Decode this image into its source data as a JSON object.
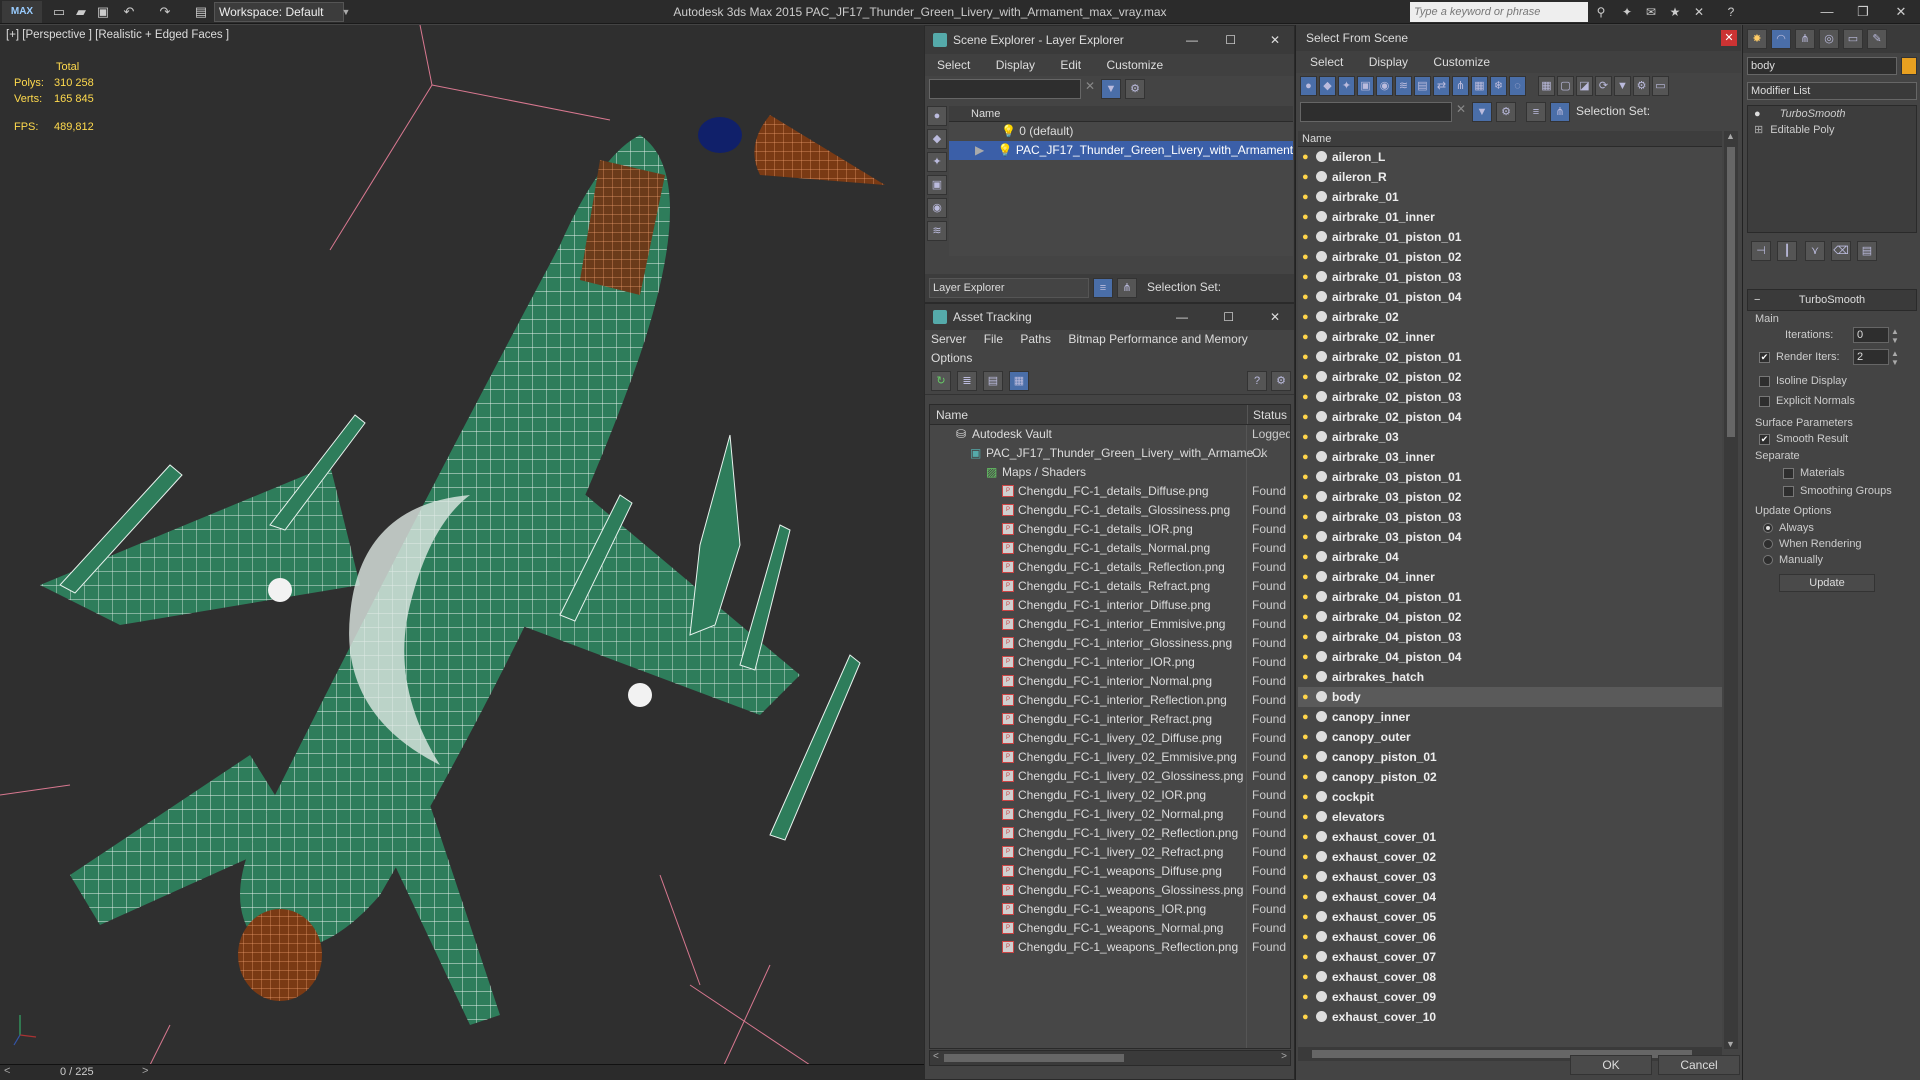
{
  "titlebar": {
    "logo": "MAX",
    "workspace": "Workspace: Default",
    "title": "Autodesk 3ds Max  2015     PAC_JF17_Thunder_Green_Livery_with_Armament_max_vray.max",
    "search_placeholder": "Type a keyword or phrase"
  },
  "viewport": {
    "label": "[+] [Perspective ] [Realistic + Edged Faces ]",
    "stats": {
      "total_label": "Total",
      "polys_label": "Polys:",
      "polys": "310 258",
      "verts_label": "Verts:",
      "verts": "165 845",
      "fps_label": "FPS:",
      "fps": "489,812"
    },
    "frame": "0 / 225"
  },
  "scene_explorer": {
    "title": "Scene Explorer - Layer Explorer",
    "menu": [
      "Select",
      "Display",
      "Edit",
      "Customize"
    ],
    "col_name": "Name",
    "layers": [
      "0 (default)",
      "PAC_JF17_Thunder_Green_Livery_with_Armament"
    ],
    "footer_mode": "Layer Explorer",
    "selection_set": "Selection Set:"
  },
  "asset_tracking": {
    "title": "Asset Tracking",
    "menu": [
      "Server",
      "File",
      "Paths",
      "Bitmap Performance and Memory"
    ],
    "menu2": "Options",
    "col_name": "Name",
    "col_status": "Status",
    "vault": {
      "name": "Autodesk Vault",
      "status": "Logged"
    },
    "file": {
      "name": "PAC_JF17_Thunder_Green_Livery_with_Armame...",
      "status": "Ok"
    },
    "maps": "Maps / Shaders",
    "found": "Found",
    "textures": [
      "Chengdu_FC-1_details_Diffuse.png",
      "Chengdu_FC-1_details_Glossiness.png",
      "Chengdu_FC-1_details_IOR.png",
      "Chengdu_FC-1_details_Normal.png",
      "Chengdu_FC-1_details_Reflection.png",
      "Chengdu_FC-1_details_Refract.png",
      "Chengdu_FC-1_interior_Diffuse.png",
      "Chengdu_FC-1_interior_Emmisive.png",
      "Chengdu_FC-1_interior_Glossiness.png",
      "Chengdu_FC-1_interior_IOR.png",
      "Chengdu_FC-1_interior_Normal.png",
      "Chengdu_FC-1_interior_Reflection.png",
      "Chengdu_FC-1_interior_Refract.png",
      "Chengdu_FC-1_livery_02_Diffuse.png",
      "Chengdu_FC-1_livery_02_Emmisive.png",
      "Chengdu_FC-1_livery_02_Glossiness.png",
      "Chengdu_FC-1_livery_02_IOR.png",
      "Chengdu_FC-1_livery_02_Normal.png",
      "Chengdu_FC-1_livery_02_Reflection.png",
      "Chengdu_FC-1_livery_02_Refract.png",
      "Chengdu_FC-1_weapons_Diffuse.png",
      "Chengdu_FC-1_weapons_Glossiness.png",
      "Chengdu_FC-1_weapons_IOR.png",
      "Chengdu_FC-1_weapons_Normal.png",
      "Chengdu_FC-1_weapons_Reflection.png"
    ]
  },
  "select_from_scene": {
    "title": "Select From Scene",
    "menu": [
      "Select",
      "Display",
      "Customize"
    ],
    "selection_set": "Selection Set:",
    "col_name": "Name",
    "selected": "body",
    "objects": [
      "aileron_L",
      "aileron_R",
      "airbrake_01",
      "airbrake_01_inner",
      "airbrake_01_piston_01",
      "airbrake_01_piston_02",
      "airbrake_01_piston_03",
      "airbrake_01_piston_04",
      "airbrake_02",
      "airbrake_02_inner",
      "airbrake_02_piston_01",
      "airbrake_02_piston_02",
      "airbrake_02_piston_03",
      "airbrake_02_piston_04",
      "airbrake_03",
      "airbrake_03_inner",
      "airbrake_03_piston_01",
      "airbrake_03_piston_02",
      "airbrake_03_piston_03",
      "airbrake_03_piston_04",
      "airbrake_04",
      "airbrake_04_inner",
      "airbrake_04_piston_01",
      "airbrake_04_piston_02",
      "airbrake_04_piston_03",
      "airbrake_04_piston_04",
      "airbrakes_hatch",
      "body",
      "canopy_inner",
      "canopy_outer",
      "canopy_piston_01",
      "canopy_piston_02",
      "cockpit",
      "elevators",
      "exhaust_cover_01",
      "exhaust_cover_02",
      "exhaust_cover_03",
      "exhaust_cover_04",
      "exhaust_cover_05",
      "exhaust_cover_06",
      "exhaust_cover_07",
      "exhaust_cover_08",
      "exhaust_cover_09",
      "exhaust_cover_10"
    ],
    "ok": "OK",
    "cancel": "Cancel"
  },
  "command_panel": {
    "object_name": "body",
    "modifier_list": "Modifier List",
    "stack": [
      "TurboSmooth",
      "Editable Poly"
    ],
    "rollout_title": "TurboSmooth",
    "main": "Main",
    "iterations_label": "Iterations:",
    "iterations": "0",
    "render_iters_label": "Render Iters:",
    "render_iters": "2",
    "isoline": "Isoline Display",
    "explicit_normals": "Explicit Normals",
    "surface_params": "Surface Parameters",
    "smooth_result": "Smooth Result",
    "separate": "Separate",
    "materials": "Materials",
    "smoothing_groups": "Smoothing Groups",
    "update_options": "Update Options",
    "always": "Always",
    "when_rendering": "When Rendering",
    "manually": "Manually",
    "update_button": "Update"
  },
  "colors": {
    "selection": "#3b5fa8",
    "mesh_green": "#2e7d5b",
    "stats_yellow": "#ffda4d"
  }
}
